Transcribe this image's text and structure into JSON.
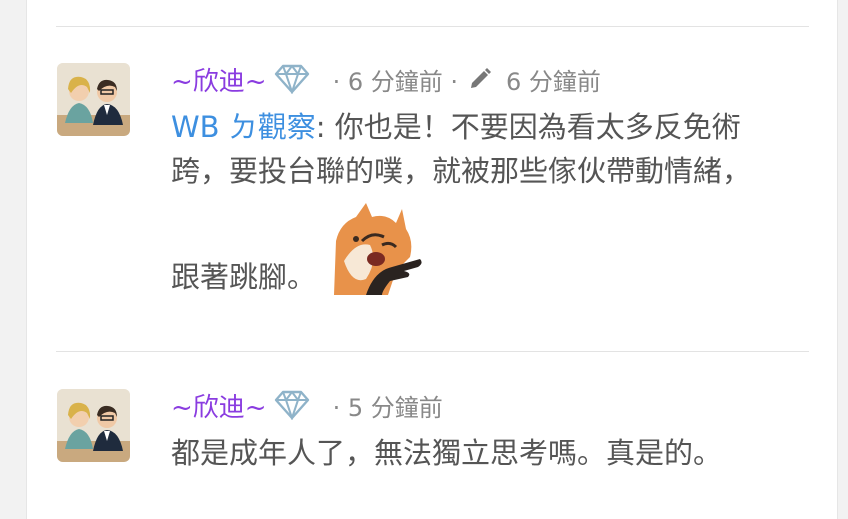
{
  "comments": [
    {
      "author": "~欣迪~",
      "time": "· 6 分鐘前 ·",
      "edited_time": "6 分鐘前",
      "mention": "WB ㄉ觀察",
      "text_line1": ": 你也是！不要因為看太多反免術",
      "text_line2": "跨，要投台聯的噗，就被那些傢伙帶動情緒，",
      "text_line3": "跟著跳腳。",
      "icons": {
        "badge": "diamond-icon",
        "edit": "pencil-icon",
        "sticker": "fox-sticker"
      }
    },
    {
      "author": "~欣迪~",
      "time": "· 5 分鐘前",
      "text": "都是成年人了，無法獨立思考嗎。真是的。",
      "icons": {
        "badge": "diamond-icon"
      }
    }
  ],
  "colors": {
    "author": "#8a3ce0",
    "mention": "#3d8fe0",
    "text": "#555555",
    "meta": "#888888"
  }
}
